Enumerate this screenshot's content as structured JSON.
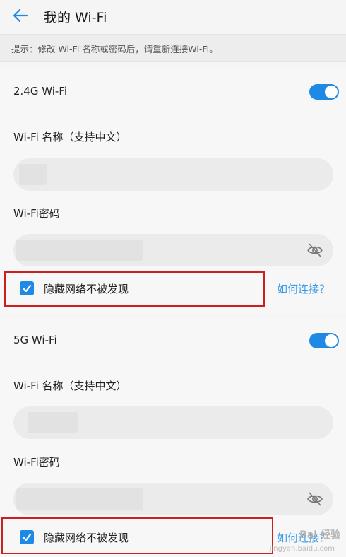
{
  "header": {
    "back_icon": "back-arrow-icon",
    "title": "我的 Wi-Fi"
  },
  "tip": "提示：修改 Wi-Fi 名称或密码后，请重新连接Wi-Fi。",
  "sections": [
    {
      "band": "2.4G Wi-Fi",
      "enabled": true,
      "name_label": "Wi-Fi 名称（支持中文）",
      "name_value": "",
      "password_label": "Wi-Fi密码",
      "password_value": "",
      "hide_checked": true,
      "hide_label": "隐藏网络不被发现",
      "help_link": "如何连接？"
    },
    {
      "band": "5G Wi-Fi",
      "enabled": true,
      "name_label": "Wi-Fi 名称（支持中文）",
      "name_value": "",
      "password_label": "Wi-Fi密码",
      "password_value": "",
      "hide_checked": true,
      "hide_label": "隐藏网络不被发现",
      "help_link": "如何连接？"
    }
  ],
  "colors": {
    "accent": "#1f8ae6",
    "link": "#3d9be9",
    "highlight": "#cc1f1f"
  },
  "watermark": {
    "brand": "Bai 经验",
    "url": "jingyan.baidu.com"
  }
}
